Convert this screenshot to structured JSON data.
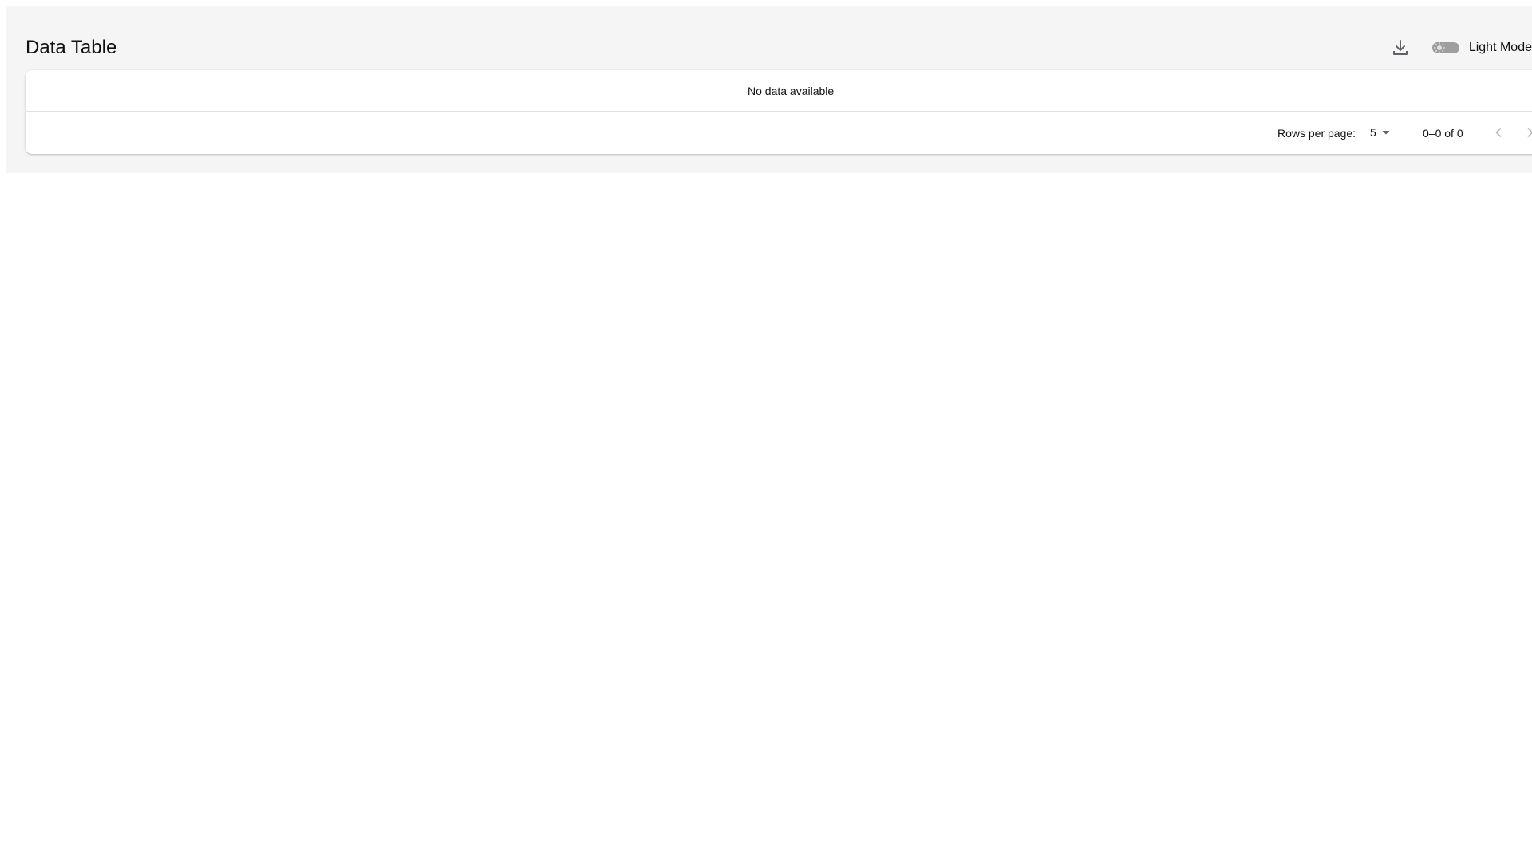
{
  "header": {
    "title": "Data Table",
    "download_icon": "download-icon",
    "theme_toggle": {
      "label": "Light Mode",
      "checked": false,
      "icon": "sun-icon"
    }
  },
  "table": {
    "empty_message": "No data available"
  },
  "pagination": {
    "rows_per_page_label": "Rows per page:",
    "rows_per_page_value": "5",
    "range_text": "0–0 of 0",
    "prev_icon": "chevron-left-icon",
    "next_icon": "chevron-right-icon"
  },
  "colors": {
    "panel_background": "#f5f5f5",
    "card_background": "#ffffff",
    "divider": "#e0e0e0",
    "icon": "#5f6368",
    "toggle_track": "#9e9e9e",
    "disabled_icon": "#bdbdbd"
  }
}
